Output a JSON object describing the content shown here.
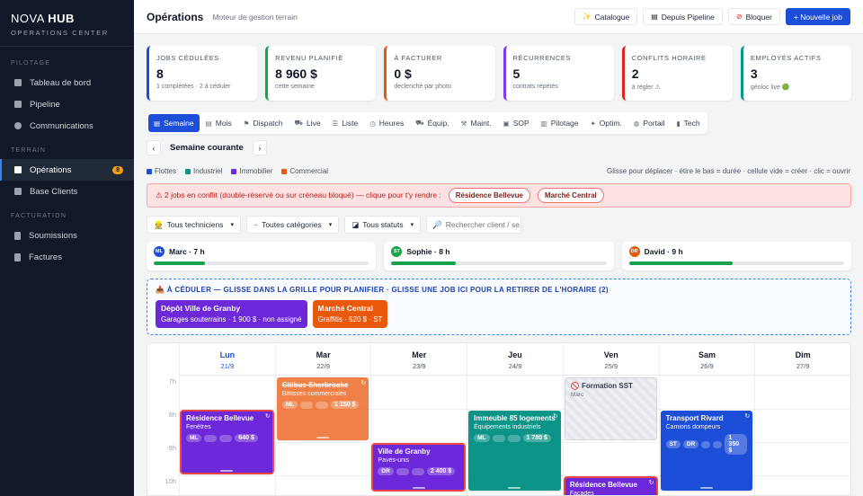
{
  "brand": {
    "name_light": "NOVA ",
    "name_bold": "HUB",
    "subtitle": "OPERATIONS CENTER"
  },
  "sidebar": {
    "sections": [
      {
        "label": "PILOTAGE",
        "items": [
          {
            "label": "Tableau de bord",
            "icon": "dashboard-icon"
          },
          {
            "label": "Pipeline",
            "icon": "pipeline-icon"
          },
          {
            "label": "Communications",
            "icon": "chat-icon"
          }
        ]
      },
      {
        "label": "TERRAIN",
        "items": [
          {
            "label": "Opérations",
            "icon": "calendar-icon",
            "active": true,
            "badge": "8"
          },
          {
            "label": "Base Clients",
            "icon": "clients-icon"
          }
        ]
      },
      {
        "label": "FACTURATION",
        "items": [
          {
            "label": "Soumissions",
            "icon": "document-icon"
          },
          {
            "label": "Factures",
            "icon": "invoice-icon"
          }
        ]
      }
    ]
  },
  "header": {
    "title": "Opérations",
    "subtitle": "Moteur de gestion terrain",
    "actions": {
      "catalogue": "Catalogue",
      "pipeline": "Depuis Pipeline",
      "block": "Bloquer",
      "new_job": "+ Nouvelle job"
    }
  },
  "kpis": [
    {
      "label": "JOBS CÉDULÉES",
      "value": "8",
      "sub": "1 complétées · 2 à céduler",
      "color": "#1d4ed8"
    },
    {
      "label": "REVENU PLANIFIÉ",
      "value": "8 960 $",
      "sub": "cette semaine",
      "color": "#16a34a"
    },
    {
      "label": "À FACTURER",
      "value": "0 $",
      "sub": "declenché par photo",
      "color": "#ea580c"
    },
    {
      "label": "RÉCURRENCES",
      "value": "5",
      "sub": "contrats répétés",
      "color": "#7c3aed"
    },
    {
      "label": "CONFLITS HORAIRE",
      "value": "2",
      "sub": "à régler ⚠",
      "color": "#dc2626"
    },
    {
      "label": "EMPLOYÉS ACTIFS",
      "value": "3",
      "sub": "géoloc live 🟢",
      "color": "#0d9488"
    }
  ],
  "tabs": [
    {
      "label": "Semaine",
      "icon": "▦",
      "active": true
    },
    {
      "label": "Mois",
      "icon": "▤"
    },
    {
      "label": "Dispatch",
      "icon": "⚑"
    },
    {
      "label": "Live",
      "icon": "⛟"
    },
    {
      "label": "Liste",
      "icon": "☰"
    },
    {
      "label": "Heures",
      "icon": "◷"
    },
    {
      "label": "Équip.",
      "icon": "⛟"
    },
    {
      "label": "Maint.",
      "icon": "⚒"
    },
    {
      "label": "SOP",
      "icon": "▣"
    },
    {
      "label": "Pilotage",
      "icon": "▥"
    },
    {
      "label": "Optim.",
      "icon": "✦"
    },
    {
      "label": "Portail",
      "icon": "◍"
    },
    {
      "label": "Tech",
      "icon": "▮"
    }
  ],
  "week": {
    "label": "Semaine courante",
    "prev": "‹",
    "next": "›"
  },
  "legend": [
    {
      "label": "Flottes",
      "color": "#1d4ed8"
    },
    {
      "label": "Industriel",
      "color": "#0d9488"
    },
    {
      "label": "Immobilier",
      "color": "#6d28d9"
    },
    {
      "label": "Commercial",
      "color": "#ea580c"
    }
  ],
  "hint": "Glisse pour déplacer · étire le bas = durée · cellule vide = créer · clic = ouvrir",
  "conflict": {
    "text": "⚠ 2 jobs en conflit (double-réservé ou sur créneau bloqué) — clique pour t'y rendre :",
    "links": [
      "Résidence Bellevue",
      "Marché Central"
    ]
  },
  "filters": {
    "tech": "Tous techniciens",
    "category": "Toutes catégories",
    "status": "Tous statuts",
    "search_placeholder": "Rechercher client / serv..."
  },
  "techs": [
    {
      "initials": "ML",
      "label": "Marc · 7 h",
      "color": "#1d4ed8",
      "load": 0.08
    },
    {
      "initials": "ST",
      "label": "Sophie · 8 h",
      "color": "#16a34a",
      "load": 0.1
    },
    {
      "initials": "DR",
      "label": "David · 9 h",
      "color": "#ea580c",
      "load": 0.16
    }
  ],
  "unscheduled": {
    "title": "📥 À CÉDULER — GLISSE DANS LA GRILLE POUR PLANIFIER · GLISSE UNE JOB ICI POUR LA RETIRER DE L'HORAIRE (2)",
    "cards": [
      {
        "title": "Dépôt Ville de Granby",
        "sub": "Garages souterrains · 1 900 $ · non assigné",
        "color": "#6d28d9"
      },
      {
        "title": "Marché Central",
        "sub": "Graffitis · 520 $ · ST",
        "color": "#ea580c"
      }
    ]
  },
  "calendar": {
    "days": [
      {
        "name": "Lun",
        "date": "21/9",
        "today": true
      },
      {
        "name": "Mar",
        "date": "22/9"
      },
      {
        "name": "Mer",
        "date": "23/9"
      },
      {
        "name": "Jeu",
        "date": "24/9"
      },
      {
        "name": "Ven",
        "date": "25/9"
      },
      {
        "name": "Sam",
        "date": "26/9"
      },
      {
        "name": "Dim",
        "date": "27/9"
      }
    ],
    "hours": [
      "7h",
      "8h",
      "9h",
      "10h"
    ],
    "jobs": [
      {
        "title": "Résidence Bellevue",
        "sub": "Fenêtres",
        "tech": "ML",
        "price": "640 $",
        "color": "#6d28d9",
        "day": 0,
        "start": 8,
        "end": 10,
        "conflict": true,
        "recurring": true
      },
      {
        "title": "Citibus Sherbrooke",
        "sub": "Bâtisses commerciales",
        "tech": "ML",
        "price": "1 150 $",
        "color": "#ea580c",
        "day": 1,
        "start": 7,
        "end": 9,
        "done": true,
        "recurring": true
      },
      {
        "title": "Ville de Granby",
        "sub": "Pavés-unis",
        "tech": "DR",
        "price": "2 400 $",
        "color": "#6d28d9",
        "day": 2,
        "start": 9,
        "end": 10.5,
        "conflict": true
      },
      {
        "title": "Immeuble 85 logements",
        "sub": "Équipements industriels",
        "tech": "ML",
        "price": "1 780 $",
        "color": "#0d9488",
        "day": 3,
        "start": 8,
        "end": 10.5,
        "recurring": true
      },
      {
        "title": "Résidence Bellevue",
        "sub": "Façades",
        "tech": "",
        "price": "",
        "color": "#6d28d9",
        "day": 4,
        "start": 10,
        "end": 11,
        "conflict": true,
        "recurring": true
      },
      {
        "title": "Transport Rivard",
        "sub": "Camions dompeurs",
        "tech": "ST",
        "extra": "DR",
        "price": "1 350 $",
        "color": "#1d4ed8",
        "day": 5,
        "start": 8,
        "end": 10.5,
        "recurring": true
      }
    ],
    "blocks": [
      {
        "title": "🚫 Formation SST",
        "sub": "Marc",
        "day": 4,
        "start": 7,
        "end": 9
      }
    ]
  }
}
